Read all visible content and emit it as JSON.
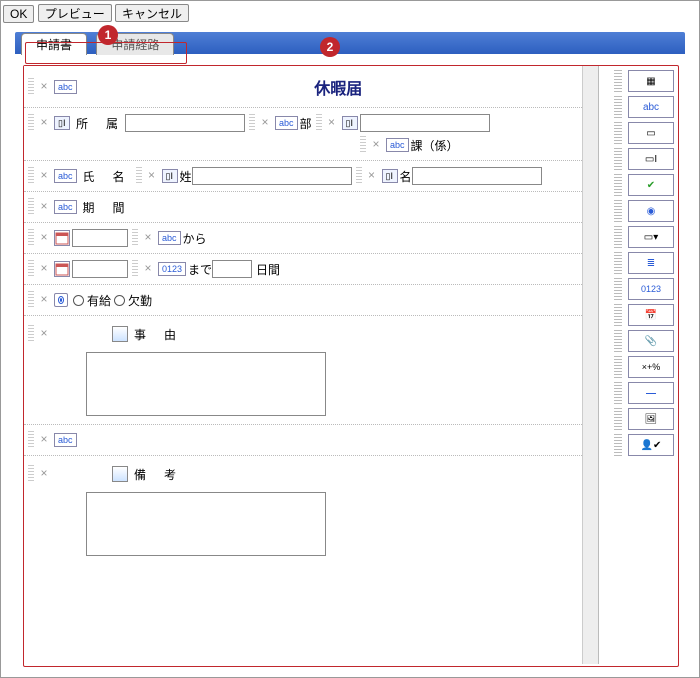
{
  "toolbar": {
    "ok": "OK",
    "preview": "プレビュー",
    "cancel": "キャンセル"
  },
  "callouts": {
    "c1": "1",
    "c2": "2"
  },
  "tabs": {
    "active": "申請書",
    "inactive": "申請経路"
  },
  "form": {
    "title": "休暇届",
    "affiliation_label": "所　属",
    "dept_suffix": "部",
    "section_suffix": "課（係）",
    "name_label": "氏　名",
    "surname_label": "姓",
    "given_label": "名",
    "period_label": "期　間",
    "from_label": "から",
    "to_label": "まで",
    "days_label": "日間",
    "paid_label": "有給",
    "absent_label": "欠勤",
    "reason_label": "事　由",
    "remarks_label": "備　考"
  },
  "chips": {
    "abc": "abc",
    "num": "0123"
  },
  "palette": {
    "items": [
      {
        "name": "layout-icon",
        "label": "▦"
      },
      {
        "name": "text-label-icon",
        "label": "abc"
      },
      {
        "name": "textarea-icon",
        "label": "▭"
      },
      {
        "name": "textbox-icon",
        "label": "▭I"
      },
      {
        "name": "checkbox-icon",
        "label": "✔"
      },
      {
        "name": "radio-icon",
        "label": "◉"
      },
      {
        "name": "dropdown-icon",
        "label": "▭▾"
      },
      {
        "name": "list-icon",
        "label": "≣"
      },
      {
        "name": "number-icon",
        "label": "0123"
      },
      {
        "name": "date-icon",
        "label": "📅"
      },
      {
        "name": "attachment-icon",
        "label": "📎"
      },
      {
        "name": "calc-icon",
        "label": "×+%"
      },
      {
        "name": "separator-icon",
        "label": "—"
      },
      {
        "name": "image-icon",
        "label": "🖼"
      },
      {
        "name": "user-select-icon",
        "label": "👤✔"
      }
    ]
  }
}
